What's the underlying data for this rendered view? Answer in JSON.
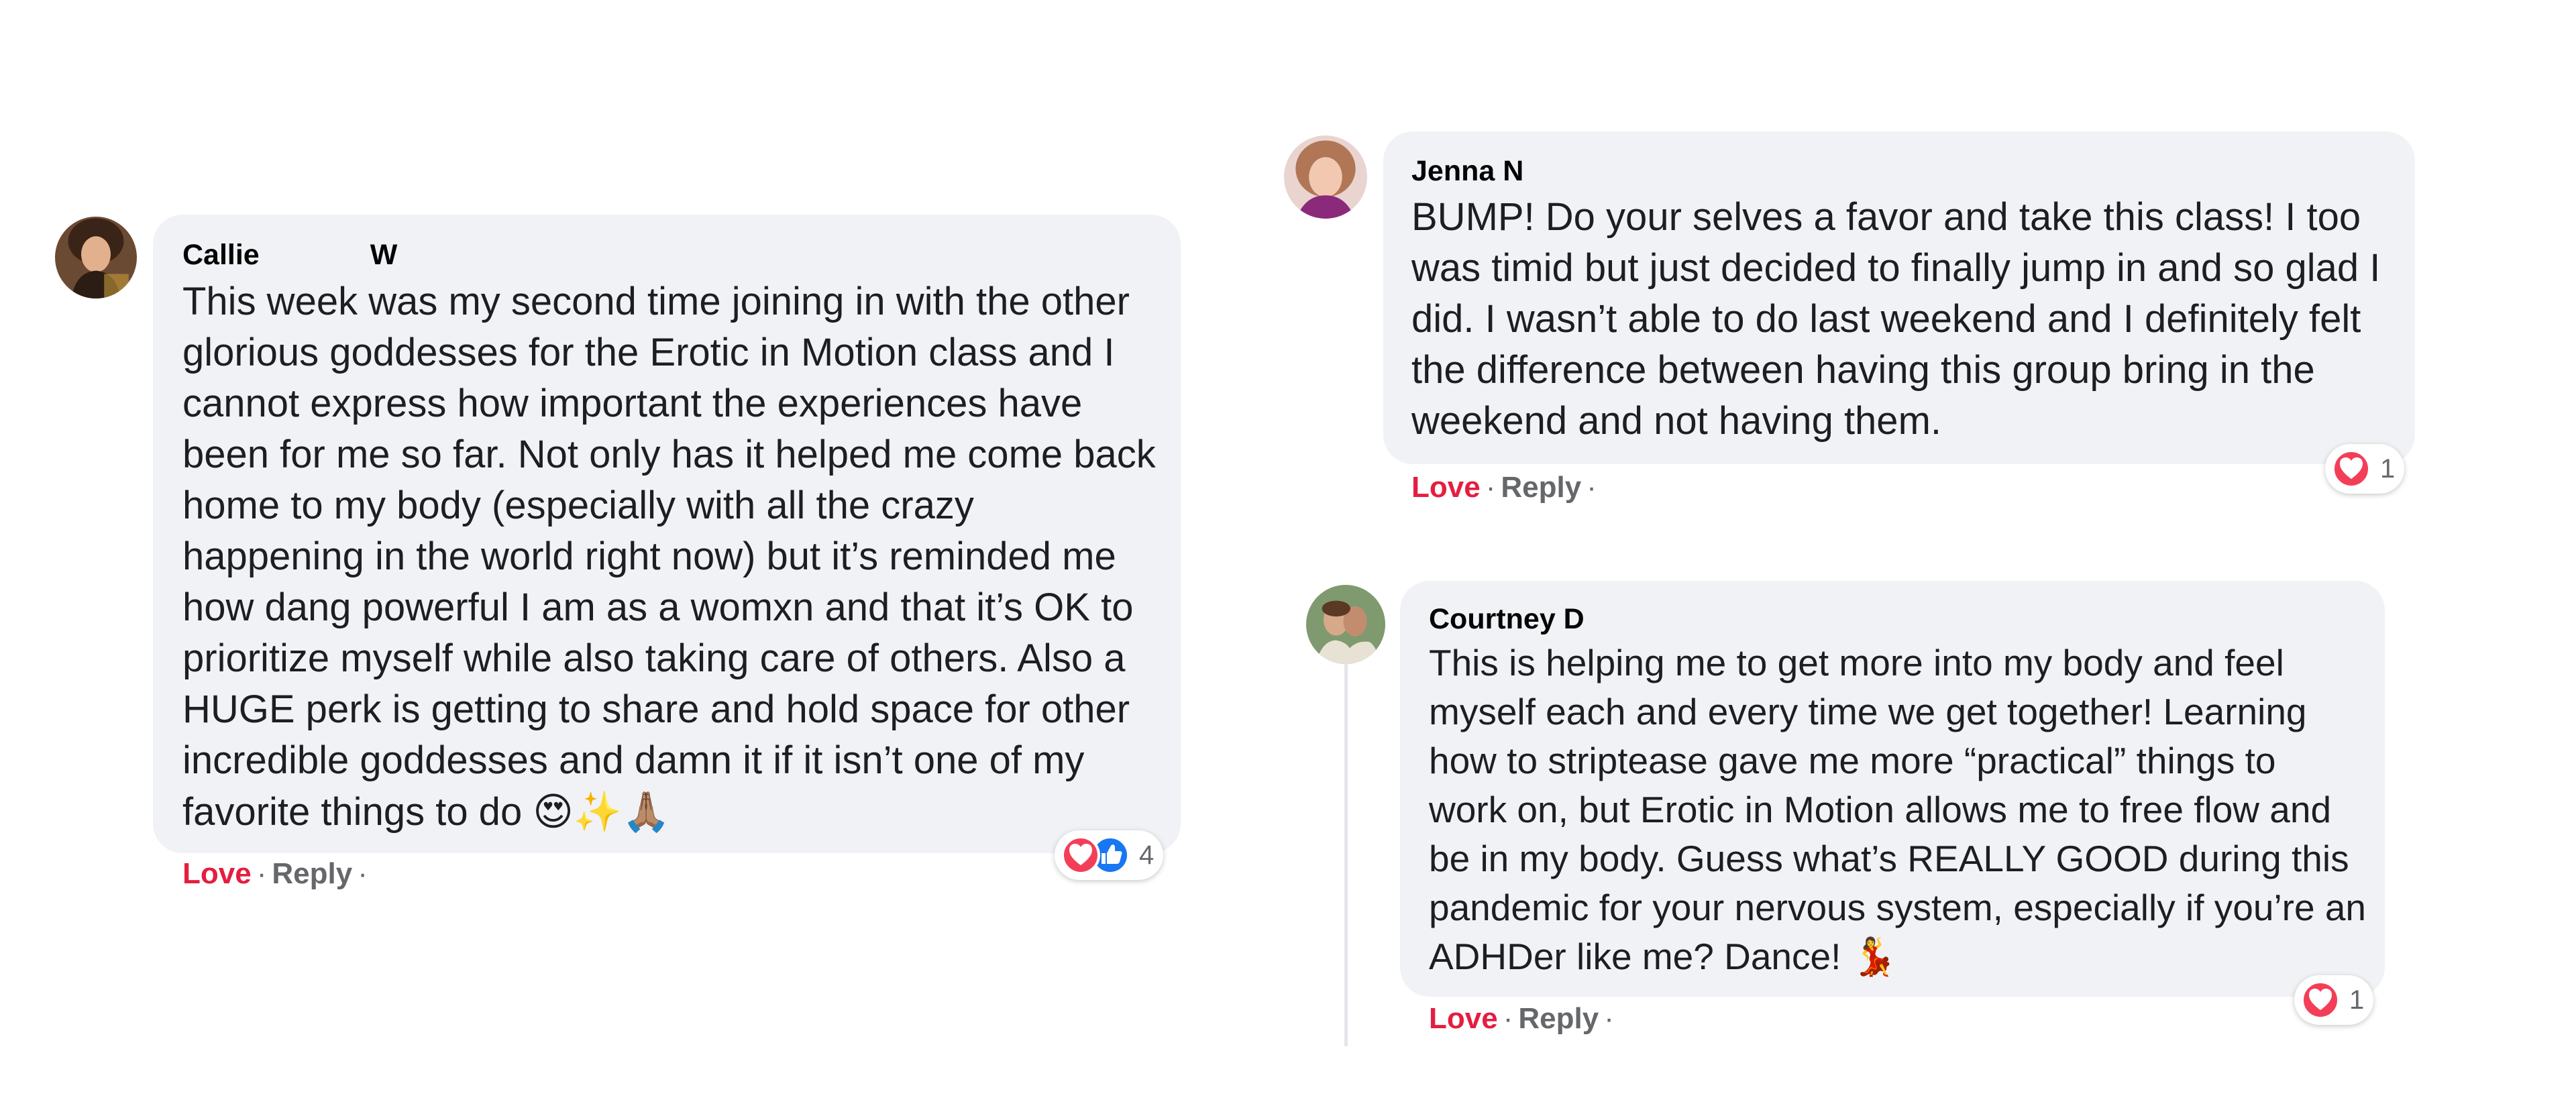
{
  "comments": [
    {
      "author_first": "Callie",
      "author_last": "W",
      "lines": [
        "This week was my second time joining in with the other",
        "glorious goddesses for the Erotic in Motion class and I",
        "cannot express how important the experiences have",
        "been for me so far. Not only has it helped me come back",
        "home to my body (especially with all the crazy",
        "happening in the world right now) but it’s reminded me",
        "how dang powerful I am as a womxn and that it’s OK to",
        "prioritize myself while also taking care of others. Also a",
        "HUGE perk is getting to share and hold space for other",
        "incredible goddesses and damn it if it isn’t one of my",
        "favorite things to do"
      ],
      "emoji": "😍✨🙏🏽",
      "love_label": "Love",
      "reply_label": "Reply",
      "reaction_count": "4",
      "reaction_icons": [
        "heart-icon",
        "like-icon"
      ]
    },
    {
      "author": "Jenna N",
      "lines": [
        "BUMP! Do your selves a favor and take this class! I too",
        "was timid but just decided to finally jump in and so glad I",
        "did. I wasn’t able to do last weekend and I definitely felt",
        "the difference between having this group bring in the",
        "weekend and not having them."
      ],
      "love_label": "Love",
      "reply_label": "Reply",
      "reaction_count": "1",
      "reaction_icons": [
        "heart-icon"
      ]
    },
    {
      "author": "Courtney D",
      "lines": [
        "This is helping me to get more into my body and feel",
        "myself each and every time we get together! Learning",
        "how to striptease gave me more “practical” things to",
        "work on, but Erotic in Motion allows me to free flow and",
        "be in my body. Guess what’s REALLY GOOD during this",
        "pandemic for your nervous system, especially if you’re an",
        "ADHDer like me? Dance!"
      ],
      "emoji": "💃",
      "love_label": "Love",
      "reply_label": "Reply",
      "reaction_count": "1",
      "reaction_icons": [
        "heart-icon"
      ]
    }
  ],
  "separator": "·",
  "colors": {
    "bubble": "#f0f2f5",
    "love": "#e41e3f",
    "meta": "#65676b",
    "heart_reaction": "#f33e58",
    "like_reaction": "#1877f2"
  }
}
